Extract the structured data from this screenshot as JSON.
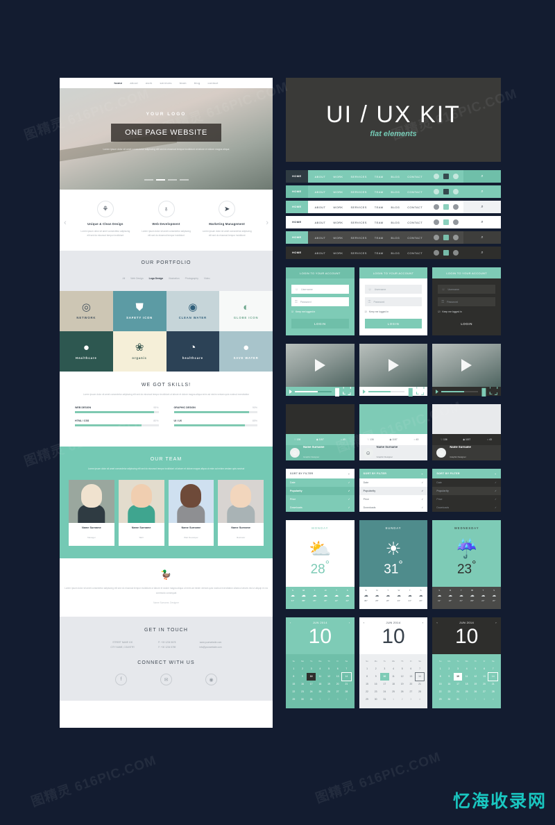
{
  "kit": {
    "title": "UI / UX KIT",
    "subtitle": "flat elements"
  },
  "watermarks": [
    "图精灵 616PIC.COM",
    "图精灵 616PIC.COM",
    "图精灵 616PIC.COM",
    "图精灵 616PIC.COM",
    "图精灵 616PIC.COM",
    "图精灵 616PIC.COM"
  ],
  "brandmark": "忆海收录网",
  "colors": {
    "background": "#131c30",
    "accent": "#74c9b4",
    "dark": "#3a3a38",
    "light": "#e6e8ec"
  },
  "page": {
    "nav": [
      "home",
      "about",
      "work",
      "services",
      "team",
      "blog",
      "contact"
    ],
    "hero": {
      "logo": "YOUR LOGO",
      "button": "ONE PAGE WEBSITE",
      "subtitle": "Lorem ipsum dolor sit amet consectetur adipiscing elit sed do eiusmod tempor incididunt ut labore et dolore magna aliqua"
    },
    "features": [
      {
        "icon": "bulb-icon",
        "glyph": "⚘",
        "title": "Unique & Clean Design",
        "desc": "Lorem ipsum dolor sit amet consectetur adipiscing elit sed do eiusmod tempor incididunt"
      },
      {
        "icon": "globe-icon",
        "glyph": "♁",
        "title": "Web Development",
        "desc": "Lorem ipsum dolor sit amet consectetur adipiscing elit sed do eiusmod tempor incididunt"
      },
      {
        "icon": "rocket-icon",
        "glyph": "➤",
        "title": "Marketing Management",
        "desc": "Lorem ipsum dolor sit amet consectetur adipiscing elit sed do eiusmod tempor incididunt"
      }
    ],
    "portfolio": {
      "title": "OUR PORTFOLIO",
      "filters": [
        "All",
        "Web Design",
        "Logo Design",
        "Illustration",
        "Photography",
        "Video"
      ],
      "active_filter": "Logo Design",
      "tiles": [
        {
          "label": "NETWORK",
          "glyph": "◎",
          "bg": "#cdc6b4",
          "fg": "#44525e"
        },
        {
          "label": "SAFETY ICON",
          "glyph": "⛊",
          "bg": "#5c9ba4",
          "fg": "#ffffff"
        },
        {
          "label": "CLEAN WATER",
          "glyph": "◉",
          "bg": "#c6d5d9",
          "fg": "#2f5f7a"
        },
        {
          "label": "GLOBE ICON",
          "glyph": "◐",
          "bg": "#f7f9f8",
          "fg": "#6fa88f"
        },
        {
          "label": "Healthcare",
          "glyph": "●",
          "bg": "#2d5750",
          "fg": "#ffffff"
        },
        {
          "label": "organic",
          "glyph": "❀",
          "bg": "#f5efd8",
          "fg": "#3c5a52"
        },
        {
          "label": "healthcare",
          "glyph": "◔",
          "bg": "#2c4256",
          "fg": "#ffffff"
        },
        {
          "label": "SAVE WATER",
          "glyph": "●",
          "bg": "#a8c4cb",
          "fg": "#ffffff"
        }
      ]
    },
    "skills": {
      "title": "WE GOT SKILLS!",
      "desc": "Lorem ipsum dolor sit amet consectetur adipiscing elit sed do eiusmod tempor incididunt ut labore et dolore magna aliqua enim ad minim veniam quis nostrud exercitation",
      "items": [
        {
          "label": "WEB DESIGN",
          "value": "95%",
          "pct": 95
        },
        {
          "label": "HTML / CSS",
          "value": "80%",
          "pct": 80
        },
        {
          "label": "GRAPHIC DESIGN",
          "value": "90%",
          "pct": 90
        },
        {
          "label": "UI / UX",
          "value": "85%",
          "pct": 85
        }
      ]
    },
    "team": {
      "title": "OUR TEAM",
      "desc": "Lorem ipsum dolor sit amet consectetur adipiscing elit sed do eiusmod tempor incididunt ut labore et dolore magna aliqua ut enim ad minim veniam quis nostrud",
      "members": [
        {
          "name": "Name Surname",
          "role": "Manager",
          "bg": "#9aa79e",
          "skin": "#f0e2cf",
          "shirt": "#2f3b42"
        },
        {
          "name": "Name Surname",
          "role": "SEO",
          "bg": "#e3dccd",
          "skin": "#f0ceb0",
          "shirt": "#3fa58f"
        },
        {
          "name": "Name Surname",
          "role": "Web Developer",
          "bg": "#cfe0f0",
          "skin": "#6e4a39",
          "shirt": "#8e8f92"
        },
        {
          "name": "Name Surname",
          "role": "Illustrator",
          "bg": "#d8d4d1",
          "skin": "#f2d6bd",
          "shirt": "#a9b3b5"
        }
      ]
    },
    "quote": {
      "text": "Lorem ipsum dolor sit amet consectetur adipiscing elit sed do eiusmod tempor incididunt ut labore et dolore magna aliqua ut enim ad minim veniam quis nostrud exercitation ullamco laboris nisi ut aliquip ex ea commodo consequat",
      "author": "Name Surname, Designer"
    },
    "footer": {
      "title": "GET IN TOUCH",
      "columns": [
        [
          "STREET NAME 100",
          "CITY NAME, COUNTRY"
        ],
        [
          "P: +00 1234 5678",
          "F: +00 1234 5789"
        ],
        [
          "www.yourwebsite.com",
          "info@yourwebsite.com"
        ]
      ],
      "connect_title": "CONNECT WITH US",
      "social": [
        "facebook-icon",
        "twitter-icon",
        "dribbble-icon"
      ],
      "social_glyphs": [
        "f",
        "✉",
        "◉"
      ]
    }
  },
  "navbars": {
    "home_label": "HOME",
    "items": [
      "ABOUT",
      "WORK",
      "SERVICES",
      "TEAM",
      "BLOG",
      "CONTACT"
    ],
    "search_glyph": "⌕",
    "variants": [
      {
        "bg": "#7ecbb6",
        "fg": "#ffffff",
        "home_bg": "#2f3b42",
        "home_fg": "#ffffff",
        "search_bg": "#6fbfa9",
        "tab": "#2f3b42"
      },
      {
        "bg": "#7ecbb6",
        "fg": "#ffffff",
        "home_bg": "#6fbfa9",
        "home_fg": "#ffffff",
        "search_bg": "#7ecbb6",
        "tab": "#2f3b42"
      },
      {
        "bg": "#ffffff",
        "fg": "#39424c",
        "home_bg": "#7ecbb6",
        "home_fg": "#ffffff",
        "search_bg": "#f0f2f4",
        "tab": "#7ecbb6"
      },
      {
        "bg": "#ffffff",
        "fg": "#39424c",
        "home_bg": "#ffffff",
        "home_fg": "#39424c",
        "search_bg": "#ffffff",
        "tab": "#7ecbb6"
      },
      {
        "bg": "#4a4a48",
        "fg": "#d4d8da",
        "home_bg": "#7ecbb6",
        "home_fg": "#ffffff",
        "search_bg": "#3e3e3c",
        "tab": "#7ecbb6"
      },
      {
        "bg": "#2e2e2c",
        "fg": "#d4d8da",
        "home_bg": "#2e2e2c",
        "home_fg": "#ffffff",
        "search_bg": "#2e2e2c",
        "tab": "#7ecbb6"
      }
    ]
  },
  "login": {
    "title": "LOGIN TO YOUR ACCOUNT",
    "username_placeholder": "Username",
    "password_placeholder": "Password",
    "keep_label": "Keep me logged in",
    "button": "LOGIN",
    "user_glyph": "☺",
    "lock_glyph": "⚿",
    "variants": [
      {
        "bg": "#7ecbb6",
        "head_bg": "#6fbfa9",
        "field_bg": "#ffffff",
        "field_fg": "#9aa4ab",
        "btn_bg": "#6fbfa9",
        "btn_fg": "#ffffff",
        "fg": "#ffffff"
      },
      {
        "bg": "#ffffff",
        "head_bg": "#7ecbb6",
        "field_bg": "#eceef0",
        "field_fg": "#9aa4ab",
        "btn_bg": "#7ecbb6",
        "btn_fg": "#ffffff",
        "fg": "#6d757c"
      },
      {
        "bg": "#2e2e2c",
        "head_bg": "#7ecbb6",
        "field_bg": "#3d3d3a",
        "field_fg": "#8b9197",
        "btn_bg": "#2e2e2c",
        "btn_fg": "#ffffff",
        "fg": "#d4d8da"
      }
    ]
  },
  "video": {
    "variants": [
      {
        "bar_bg": "#7ecbb6",
        "fg": "#ffffff",
        "track": "#5aab96",
        "fill": "#ffffff"
      },
      {
        "bar_bg": "#ffffff",
        "fg": "#7ecbb6",
        "track": "#e4e7e9",
        "fill": "#7ecbb6"
      },
      {
        "bar_bg": "#2e2e2c",
        "fg": "#7ecbb6",
        "track": "#4a4a48",
        "fill": "#7ecbb6"
      }
    ]
  },
  "profile": {
    "name": "Name Surname",
    "role": "Graphic Designer",
    "stats": [
      {
        "icon": "heart-icon",
        "glyph": "♡",
        "value": "136"
      },
      {
        "icon": "eye-icon",
        "glyph": "◉",
        "value": "1157"
      },
      {
        "icon": "comment-icon",
        "glyph": "○",
        "value": "43"
      }
    ],
    "variants": [
      {
        "img_bg": "#2e2e2c",
        "stat_bg": "#7ecbb6",
        "stat_fg": "#ffffff",
        "user_bg": "#6fbfa9",
        "user_fg": "#ffffff"
      },
      {
        "img_bg": "#7ecbb6",
        "stat_bg": "#ffffff",
        "stat_fg": "#6d757c",
        "user_bg": "#eceef0",
        "user_fg": "#4a525a"
      },
      {
        "img_bg": "#e8eaec",
        "stat_bg": "#2e2e2c",
        "stat_fg": "#d4d8da",
        "user_bg": "#3a3a38",
        "user_fg": "#ffffff"
      }
    ]
  },
  "dropdown": {
    "header": "SORT BY FILTER",
    "items": [
      "Date",
      "Popularity",
      "Price",
      "Downloads"
    ],
    "selected": "Popularity",
    "check_glyph": "✓",
    "chevron_glyph": "⌄",
    "variants": [
      {
        "head_bg": "#ffffff",
        "head_fg": "#6d757c",
        "list_bg": "#7ecbb6",
        "list_fg": "#ffffff",
        "sel_bg": "#6fbfa9"
      },
      {
        "head_bg": "#7ecbb6",
        "head_fg": "#ffffff",
        "list_bg": "#ffffff",
        "list_fg": "#6d757c",
        "sel_bg": "#eceef0"
      },
      {
        "head_bg": "#7ecbb6",
        "head_fg": "#ffffff",
        "list_bg": "#2e2e2c",
        "list_fg": "#8b9197",
        "sel_bg": "#3d3d3a"
      }
    ]
  },
  "weather": {
    "days_short": [
      "S",
      "M",
      "T",
      "W",
      "T",
      "S"
    ],
    "forecast_temps": [
      "31°",
      "28°",
      "26°",
      "23°",
      "24°",
      "20°"
    ],
    "cards": [
      {
        "day": "MONDAY",
        "temp": "28",
        "degree": "°",
        "icon": "sun-cloud-icon",
        "glyph": "⛅",
        "bg": "#ffffff",
        "fg": "#7ecbb6",
        "foot_bg": "#7ecbb6",
        "foot_fg": "#ffffff",
        "active": 1
      },
      {
        "day": "SUNDAY",
        "temp": "31",
        "degree": "°",
        "icon": "sun-icon",
        "glyph": "☀",
        "bg": "#4f8c8c",
        "fg": "#ffffff",
        "foot_bg": "#ffffff",
        "foot_fg": "#6d757c",
        "active": 0
      },
      {
        "day": "WEDNESDAY",
        "temp": "23",
        "degree": "°",
        "icon": "rain-cloud-icon",
        "glyph": "☔",
        "bg": "#7ecbb6",
        "fg": "#2e2e2c",
        "foot_bg": "#4a4a48",
        "foot_fg": "#d4d8da",
        "active": 3
      }
    ]
  },
  "calendar": {
    "month": "JUN 2014",
    "big_day": "10",
    "prev_glyph": "‹",
    "next_glyph": "›",
    "weekdays": [
      "Su",
      "Mo",
      "Tu",
      "We",
      "Th",
      "Fr",
      "Sa"
    ],
    "weeks": [
      [
        "1",
        "2",
        "3",
        "4",
        "5",
        "6",
        "7"
      ],
      [
        "8",
        "9",
        "10",
        "11",
        "12",
        "13",
        "14"
      ],
      [
        "15",
        "16",
        "17",
        "18",
        "19",
        "20",
        "21"
      ],
      [
        "22",
        "23",
        "24",
        "25",
        "26",
        "27",
        "28"
      ],
      [
        "29",
        "30",
        "31",
        "1",
        "2",
        "3",
        "4"
      ]
    ],
    "selected": "10",
    "outlined": "14",
    "variants": [
      {
        "head_bg": "#7ecbb6",
        "head_fg": "#ffffff",
        "grid_bg": "#6fbfa9",
        "grid_fg": "#ffffff",
        "sel_bg": "#2e2e2c",
        "sel_fg": "#ffffff"
      },
      {
        "head_bg": "#ffffff",
        "head_fg": "#39424c",
        "grid_bg": "#eceef0",
        "grid_fg": "#6d757c",
        "sel_bg": "#7ecbb6",
        "sel_fg": "#ffffff"
      },
      {
        "head_bg": "#2e2e2c",
        "head_fg": "#ffffff",
        "grid_bg": "#7ecbb6",
        "grid_fg": "#ffffff",
        "sel_bg": "#ffffff",
        "sel_fg": "#2e2e2c"
      }
    ]
  }
}
